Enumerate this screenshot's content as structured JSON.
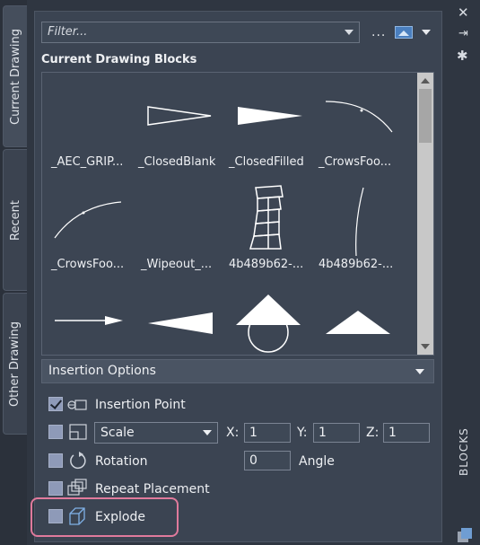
{
  "tabs": [
    {
      "label": "Current Drawing",
      "active": true
    },
    {
      "label": "Recent",
      "active": false
    },
    {
      "label": "Other Drawing",
      "active": false
    }
  ],
  "toolbar": {
    "filter_placeholder": "Filter...",
    "more_label": "...",
    "view_icon": "image-icon"
  },
  "section_title": "Current Drawing Blocks",
  "blocks": [
    {
      "label": "_AEC_GRIP...",
      "icon": "empty"
    },
    {
      "label": "_ClosedBlank",
      "icon": "closed-blank-arrow"
    },
    {
      "label": "_ClosedFilled",
      "icon": "closed-filled-arrow"
    },
    {
      "label": "_CrowsFoo...",
      "icon": "arc-dot"
    },
    {
      "label": "_CrowsFoo...",
      "icon": "arc-dot-reverse"
    },
    {
      "label": "_Wipeout_...",
      "icon": "empty"
    },
    {
      "label": "4b489b62-...",
      "icon": "tower"
    },
    {
      "label": "4b489b62-...",
      "icon": "vertical-arc"
    },
    {
      "label": "",
      "icon": "line-arrow"
    },
    {
      "label": "",
      "icon": "wedge"
    },
    {
      "label": "",
      "icon": "circle-triangle"
    },
    {
      "label": "",
      "icon": "triangle"
    }
  ],
  "insertion": {
    "header": "Insertion Options",
    "insertion_point": {
      "label": "Insertion Point",
      "checked": true
    },
    "scale": {
      "value": "Scale",
      "checked": false,
      "x_label": "X:",
      "x": "1",
      "y_label": "Y:",
      "y": "1",
      "z_label": "Z:",
      "z": "1"
    },
    "rotation": {
      "label": "Rotation",
      "checked": false,
      "value": "0",
      "angle_label": "Angle"
    },
    "repeat": {
      "label": "Repeat Placement",
      "checked": false
    },
    "explode": {
      "label": "Explode",
      "checked": false
    }
  },
  "right_bar": {
    "label": "BLOCKS"
  },
  "colors": {
    "accent_highlight": "#e07a9c",
    "panel": "#3b4452"
  }
}
